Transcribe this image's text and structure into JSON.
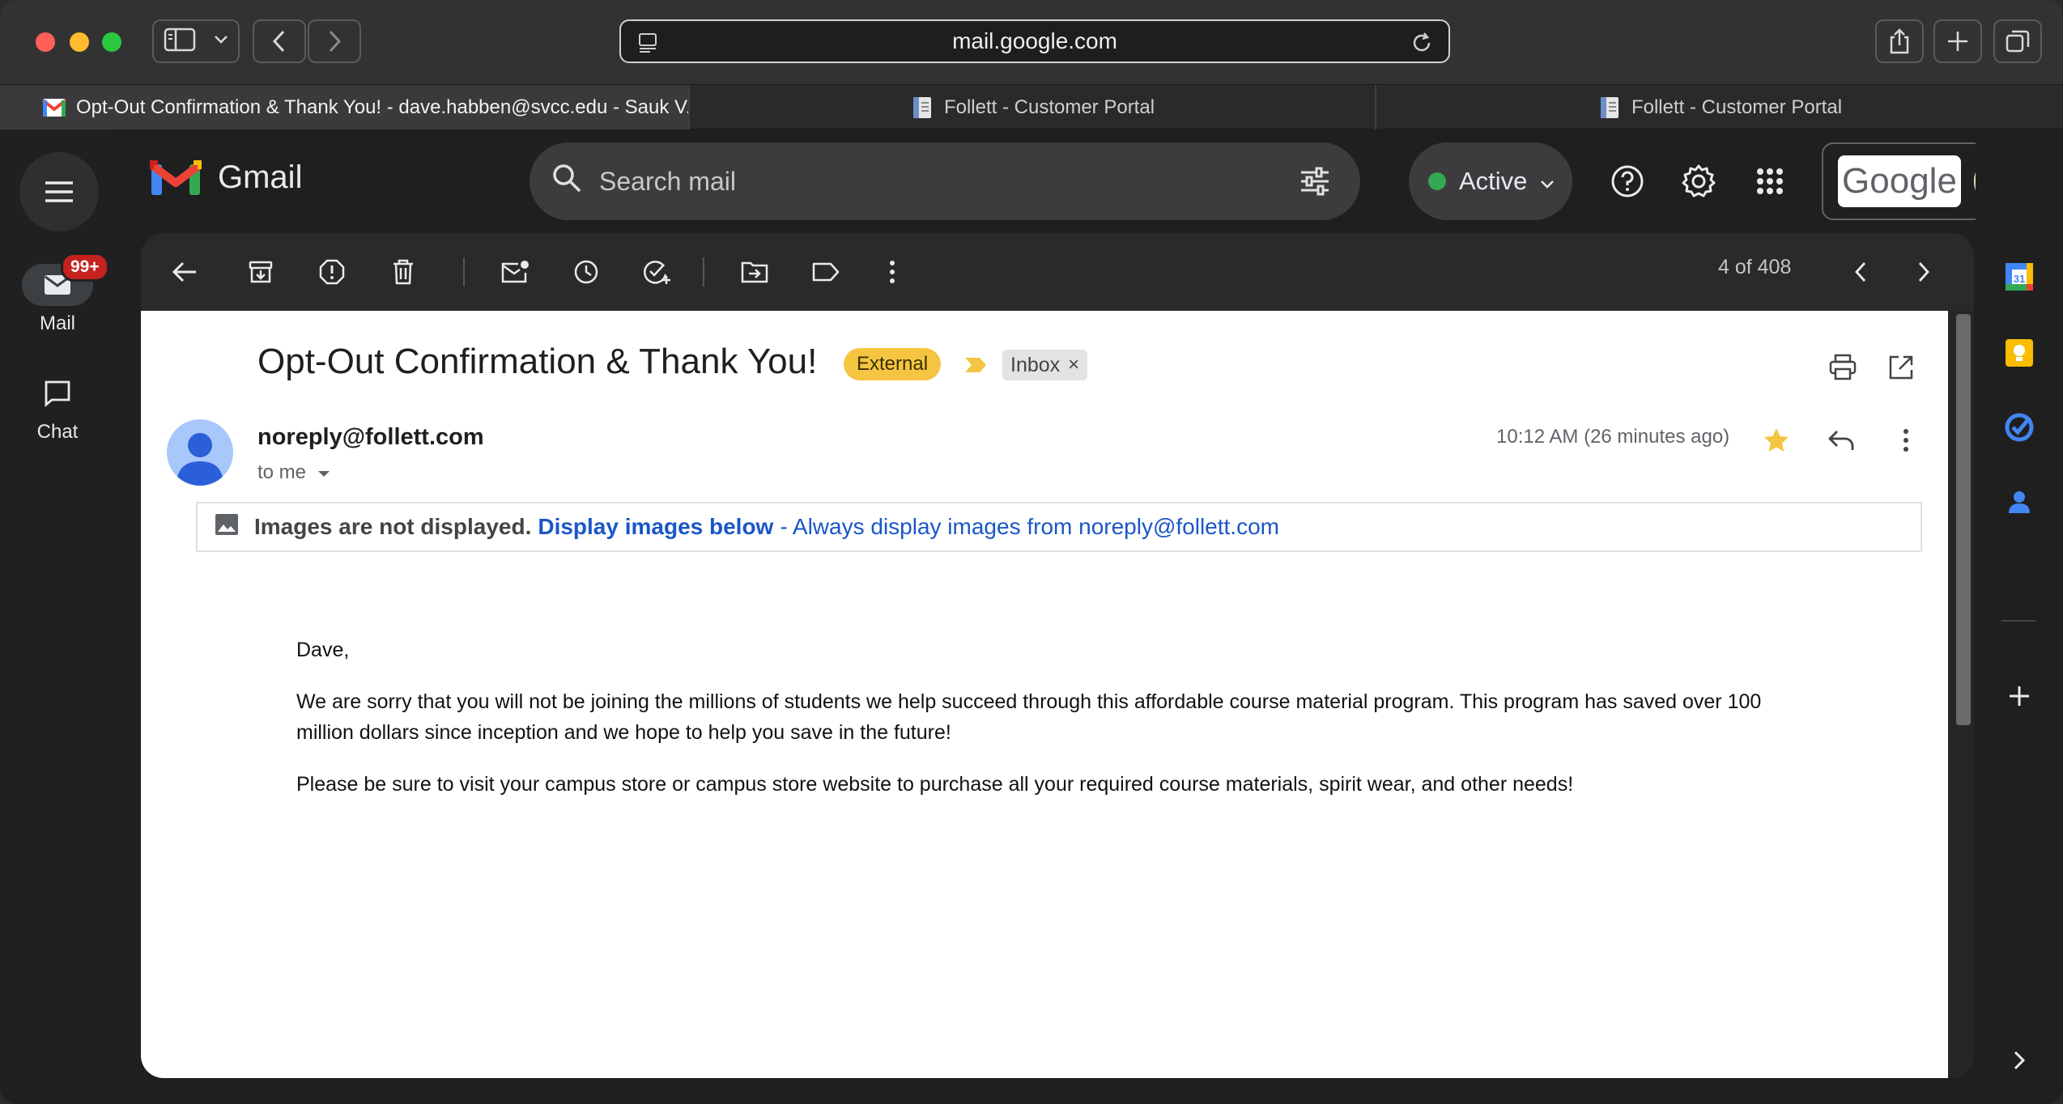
{
  "browser": {
    "address": "mail.google.com",
    "tabs": [
      {
        "label": "Opt-Out Confirmation & Thank You! - dave.habben@svcc.edu - Sauk V..."
      },
      {
        "label": "Follett - Customer Portal"
      },
      {
        "label": "Follett - Customer Portal"
      }
    ]
  },
  "gmail": {
    "logo_text": "Gmail",
    "search_placeholder": "Search mail",
    "status": "Active",
    "account_brand": "Google",
    "rail": {
      "mail_label": "Mail",
      "mail_badge": "99+",
      "chat_label": "Chat"
    },
    "toolbar": {
      "pager": "4 of 408"
    },
    "message": {
      "subject": "Opt-Out Confirmation & Thank You!",
      "label_external": "External",
      "label_inbox": "Inbox",
      "label_inbox_remove": "×",
      "sender": "noreply@follett.com",
      "recipient": "to me",
      "time": "10:12 AM (26 minutes ago)",
      "images_notice": "Images are not displayed.",
      "display_images": "Display images below",
      "always_display": "- Always display images from noreply@follett.com",
      "greeting": "Dave,",
      "para1": "We are sorry that you will not be joining the millions of students we help succeed through this affordable course material program. This program has saved over 100 million dollars since inception and we hope to help you save in the future!",
      "para2": "Please be sure to visit your campus store or campus store website to purchase all your required course materials, spirit wear, and other needs!"
    },
    "calendar_day": "31"
  },
  "colors": {
    "accent_blue": "#1a56c8",
    "external_chip": "#f5c542",
    "star": "#f4b400",
    "badge_red": "#c5221f",
    "status_green": "#34a853"
  }
}
